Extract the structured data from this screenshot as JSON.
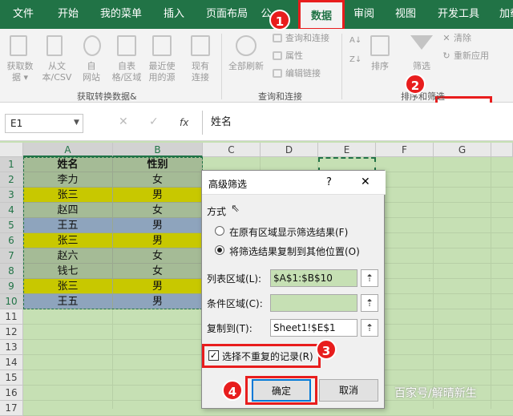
{
  "tabs": [
    "文件",
    "开始",
    "我的菜单",
    "插入",
    "页面布局",
    "公式",
    "数据",
    "审阅",
    "视图",
    "开发工具",
    "加载"
  ],
  "ribbon": {
    "get_data_label1": "获取数",
    "get_data_label2": "据 ▾",
    "from_csv1": "从文",
    "from_csv2": "本/CSV",
    "from_web1": "自",
    "from_web2": "网站",
    "from_table1": "自表",
    "from_table2": "格/区域",
    "recent1": "最近使",
    "recent2": "用的源",
    "existing1": "现有",
    "existing2": "连接",
    "refresh_all": "全部刷新",
    "query_conn": "查询和连接",
    "properties": "属性",
    "edit_links": "编辑链接",
    "sort": "排序",
    "filter": "筛选",
    "clear": "清除",
    "reapply": "重新应用",
    "advanced": "高级",
    "group_get": "获取转换数据&",
    "group_query": "查询和连接",
    "group_sort": "排序和筛选"
  },
  "namebox": "E1",
  "formula_icon": "fx",
  "formula": "姓名",
  "columns": [
    "A",
    "B",
    "C",
    "D",
    "E",
    "F",
    "G"
  ],
  "rows": [
    "1",
    "2",
    "3",
    "4",
    "5",
    "6",
    "7",
    "8",
    "9",
    "10",
    "11",
    "12",
    "13",
    "14",
    "15",
    "16",
    "17"
  ],
  "table": [
    {
      "a": "姓名",
      "b": "性别",
      "color": "#a5bb96",
      "bold": true
    },
    {
      "a": "李力",
      "b": "女",
      "color": "#a5bb96"
    },
    {
      "a": "张三",
      "b": "男",
      "color": "#c8c800"
    },
    {
      "a": "赵四",
      "b": "女",
      "color": "#a5bb96"
    },
    {
      "a": "王五",
      "b": "男",
      "color": "#8ea4bd"
    },
    {
      "a": "张三",
      "b": "男",
      "color": "#c8c800"
    },
    {
      "a": "赵六",
      "b": "女",
      "color": "#a5bb96"
    },
    {
      "a": "钱七",
      "b": "女",
      "color": "#a5bb96"
    },
    {
      "a": "张三",
      "b": "男",
      "color": "#c8c800"
    },
    {
      "a": "王五",
      "b": "男",
      "color": "#8ea4bd"
    }
  ],
  "dialog": {
    "title": "高级筛选",
    "help": "?",
    "close": "✕",
    "method": "方式",
    "opt1": "在原有区域显示筛选结果(F)",
    "opt2": "将筛选结果复制到其他位置(O)",
    "list_range_label": "列表区域(L):",
    "list_range_value": "$A$1:$B$10",
    "criteria_label": "条件区域(C):",
    "criteria_value": "",
    "copy_to_label": "复制到(T):",
    "copy_to_value": "Sheet1!$E$1",
    "unique": "选择不重复的记录(R)",
    "ok": "确定",
    "cancel": "取消",
    "collapse_icon": "⇡"
  },
  "badges": [
    "1",
    "2",
    "3",
    "4"
  ],
  "watermark": "百家号/解晴新生"
}
